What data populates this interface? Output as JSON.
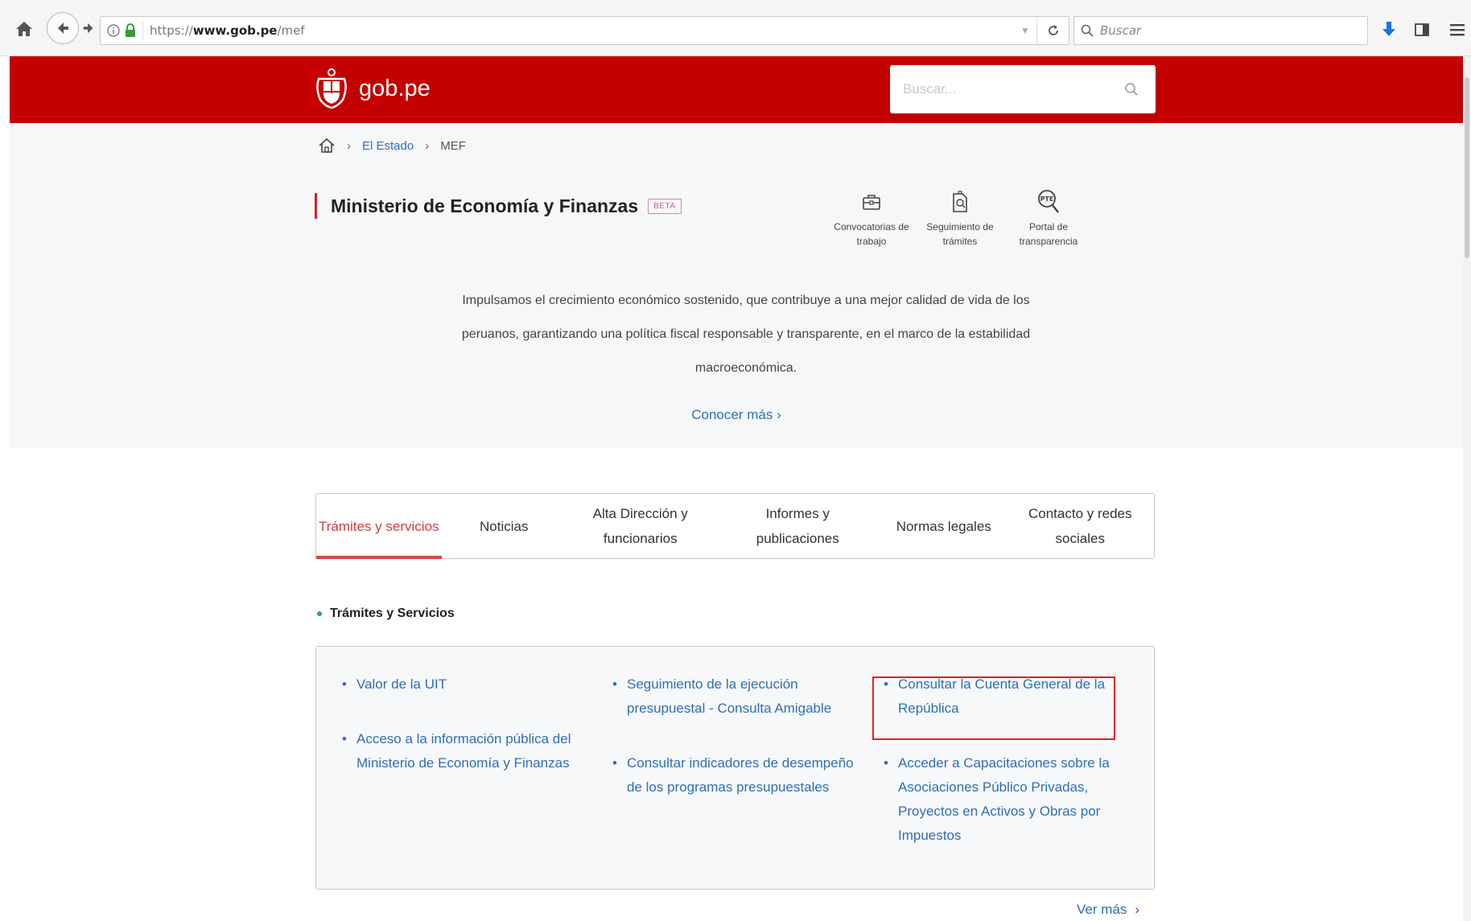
{
  "browser": {
    "url_scheme": "https://",
    "url_host": "www.gob.pe",
    "url_path": "/mef",
    "search_placeholder": "Buscar"
  },
  "header": {
    "logo_text": "gob.pe",
    "search_placeholder": "Buscar..."
  },
  "breadcrumb": {
    "items": [
      "El Estado",
      "MEF"
    ]
  },
  "org": {
    "name": "Ministerio de Economía y Finanzas",
    "badge": "BETA"
  },
  "quick_links": [
    {
      "label": "Convocatorias de trabajo",
      "icon": "briefcase-icon"
    },
    {
      "label": "Seguimiento de trámites",
      "icon": "document-search-icon"
    },
    {
      "label": "Portal de transparencia",
      "icon": "transparency-magnifier-icon"
    }
  ],
  "mission": "Impulsamos el crecimiento económico sostenido, que contribuye a una mejor calidad de vida de los peruanos, garantizando una política fiscal responsable y transparente, en el marco de la estabilidad macroeconómica.",
  "learn_more": "Conocer más ›",
  "tabs": [
    {
      "label": "Trámites y servicios",
      "active": true
    },
    {
      "label": "Noticias"
    },
    {
      "label": "Alta Dirección y funcionarios"
    },
    {
      "label": "Informes y publicaciones"
    },
    {
      "label": "Normas legales"
    },
    {
      "label": "Contacto y redes sociales"
    }
  ],
  "section_title": "Trámites y Servicios",
  "services": [
    "Valor de la UIT",
    "Acceso a la información pública del Ministerio de Economía y Finanzas",
    "Seguimiento de la ejecución presupuestal - Consulta Amigable",
    "Consultar indicadores de desempeño de los programas presupuestales",
    "Consultar la Cuenta General de la República",
    "Acceder a Capacitaciones sobre la Asociaciones Público Privadas, Proyectos en Activos y Obras por Impuestos"
  ],
  "see_more": "Ver más",
  "colors": {
    "brand_red": "#c40000",
    "link_blue": "#2f6eb5",
    "highlight_red": "#e41e1e"
  }
}
